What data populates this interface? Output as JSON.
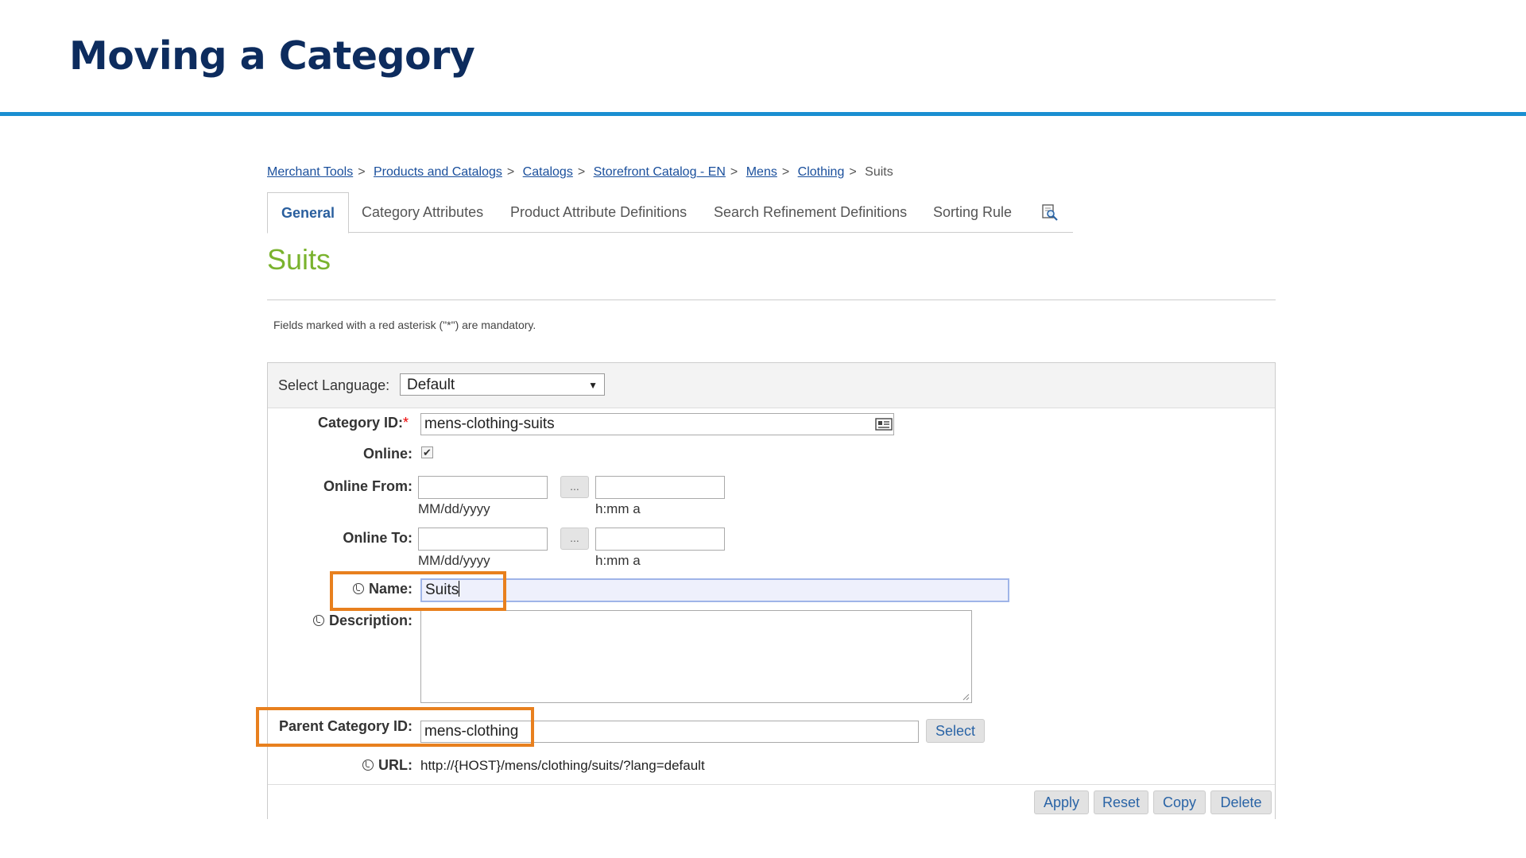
{
  "slide": {
    "title": "Moving a Category"
  },
  "breadcrumb": {
    "links": [
      "Merchant Tools",
      "Products and Catalogs",
      "Catalogs",
      "Storefront Catalog - EN",
      "Mens",
      "Clothing"
    ],
    "separator": ">",
    "current": "Suits"
  },
  "tabs": [
    {
      "label": "General",
      "active": true
    },
    {
      "label": "Category Attributes"
    },
    {
      "label": "Product Attribute Definitions"
    },
    {
      "label": "Search Refinement Definitions"
    },
    {
      "label": "Sorting Rule"
    }
  ],
  "tab_icon": "preview-magnifier-icon",
  "page": {
    "heading": "Suits",
    "mandatory_note": "Fields marked with a red asterisk (\"*\") are mandatory."
  },
  "language": {
    "label": "Select Language:",
    "selected": "Default",
    "arrow": "▼"
  },
  "form": {
    "category_id": {
      "label": "Category ID:",
      "required_mark": "*",
      "value": "mens-clothing-suits"
    },
    "online": {
      "label": "Online:",
      "checked": true,
      "check_glyph": "✔"
    },
    "online_from": {
      "label": "Online From:",
      "date_hint": "MM/dd/yyyy",
      "time_hint": "h:mm a",
      "picker_label": "..."
    },
    "online_to": {
      "label": "Online To:",
      "date_hint": "MM/dd/yyyy",
      "time_hint": "h:mm a",
      "picker_label": "..."
    },
    "name": {
      "label": "Name:",
      "value": "Suits"
    },
    "description": {
      "label": "Description:",
      "value": ""
    },
    "parent_category_id": {
      "label": "Parent Category ID:",
      "value": "mens-clothing",
      "select_label": "Select"
    },
    "url": {
      "label": "URL:",
      "value": "http://{HOST}/mens/clothing/suits/?lang=default"
    }
  },
  "actions": [
    "Apply",
    "Reset",
    "Copy",
    "Delete"
  ],
  "colors": {
    "title": "#0d2c5e",
    "rule": "#1a8fd1",
    "heading": "#7ab32e",
    "highlight": "#e8801e",
    "link": "#1a4f9c"
  }
}
